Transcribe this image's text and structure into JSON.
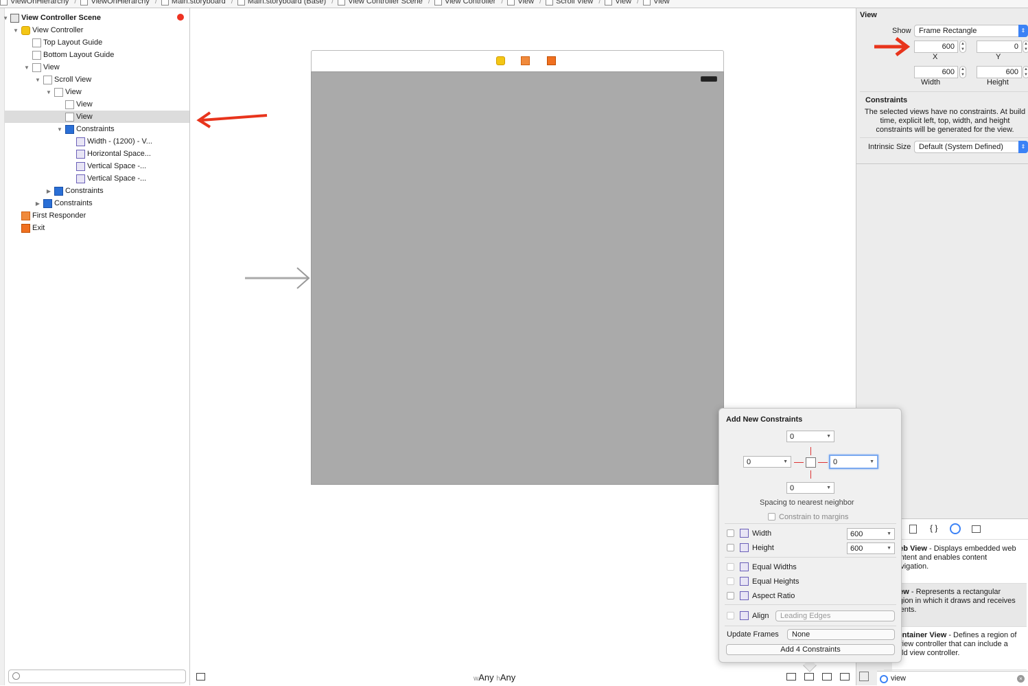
{
  "breadcrumb": [
    "ViewOnHierarchy",
    "ViewOnHierarchy",
    "Main.storyboard",
    "Main.storyboard (Base)",
    "View Controller Scene",
    "View Controller",
    "View",
    "Scroll View",
    "View",
    "View"
  ],
  "outline": [
    {
      "label": "View Controller Scene",
      "level": 0,
      "icon": "scene-icon",
      "expanded": true,
      "bold": true
    },
    {
      "label": "View Controller",
      "level": 1,
      "icon": "view-controller-icon",
      "expanded": true
    },
    {
      "label": "Top Layout Guide",
      "level": 2,
      "icon": "layout-guide-icon"
    },
    {
      "label": "Bottom Layout Guide",
      "level": 2,
      "icon": "layout-guide-icon"
    },
    {
      "label": "View",
      "level": 2,
      "icon": "view-icon",
      "expanded": true
    },
    {
      "label": "Scroll View",
      "level": 3,
      "icon": "view-icon",
      "expanded": true
    },
    {
      "label": "View",
      "level": 4,
      "icon": "view-icon",
      "expanded": true
    },
    {
      "label": "View",
      "level": 5,
      "icon": "view-icon"
    },
    {
      "label": "View",
      "level": 5,
      "icon": "view-icon",
      "selected": true
    },
    {
      "label": "Constraints",
      "level": 5,
      "icon": "constraints-icon",
      "expanded": true
    },
    {
      "label": "Width - (1200) - V...",
      "level": 6,
      "icon": "constraint-icon"
    },
    {
      "label": "Horizontal Space...",
      "level": 6,
      "icon": "constraint-icon"
    },
    {
      "label": "Vertical Space -...",
      "level": 6,
      "icon": "constraint-icon"
    },
    {
      "label": "Vertical Space -...",
      "level": 6,
      "icon": "constraint-icon"
    },
    {
      "label": "Constraints",
      "level": 4,
      "icon": "constraints-icon",
      "expanded": false
    },
    {
      "label": "Constraints",
      "level": 3,
      "icon": "constraints-icon",
      "expanded": false
    },
    {
      "label": "First Responder",
      "level": 1,
      "icon": "first-responder-icon"
    },
    {
      "label": "Exit",
      "level": 1,
      "icon": "exit-icon"
    }
  ],
  "canvas": {
    "size_class_w": "Any",
    "size_class_h": "Any",
    "w_prefix": "w",
    "h_prefix": "h"
  },
  "popover": {
    "title": "Add New Constraints",
    "top": "0",
    "left": "0",
    "right": "0",
    "bottom": "0",
    "spacing_label": "Spacing to nearest neighbor",
    "constrain_margins": "Constrain to margins",
    "width_label": "Width",
    "width_value": "600",
    "height_label": "Height",
    "height_value": "600",
    "equal_widths": "Equal Widths",
    "equal_heights": "Equal Heights",
    "aspect_ratio": "Aspect Ratio",
    "align_label": "Align",
    "align_value": "Leading Edges",
    "update_frames_label": "Update Frames",
    "update_frames_value": "None",
    "add_button": "Add 4 Constraints"
  },
  "inspector": {
    "section": "View",
    "show_label": "Show",
    "show_value": "Frame Rectangle",
    "x": "600",
    "y": "0",
    "width": "600",
    "height": "600",
    "x_label": "X",
    "y_label": "Y",
    "width_label": "Width",
    "height_label": "Height",
    "constraints_title": "Constraints",
    "constraints_text": "The selected views have no constraints. At build time, explicit left, top, width, and height constraints will be generated for the view.",
    "intrinsic_label": "Intrinsic Size",
    "intrinsic_value": "Default (System Defined)"
  },
  "library": {
    "items": [
      {
        "name": "Web View",
        "desc": " - Displays embedded web content and enables content navigation."
      },
      {
        "name": "View",
        "desc": " - Represents a rectangular region in which it draws and receives events."
      },
      {
        "name": "Container View",
        "desc": " - Defines a region of a view controller that can include a child view controller."
      }
    ],
    "filter": "view"
  },
  "colors": {
    "annotation_arrow": "#e8341c",
    "selection": "#dcdcdc",
    "accent": "#3b82f6"
  }
}
